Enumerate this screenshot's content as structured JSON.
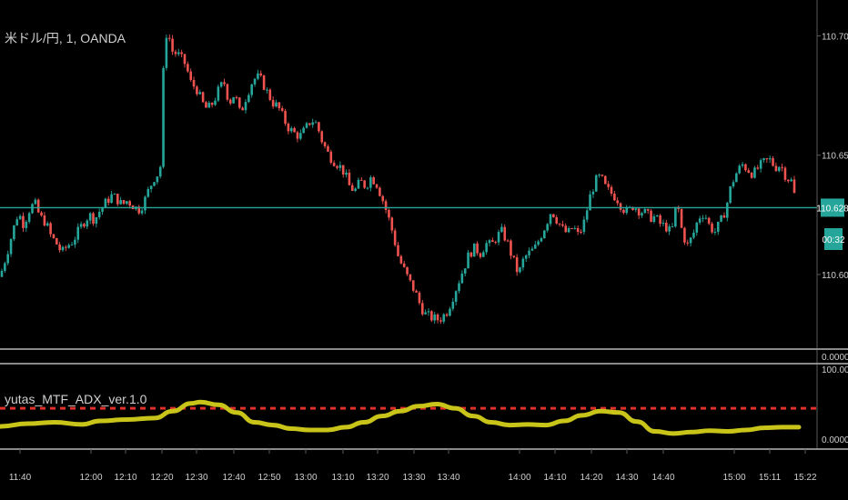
{
  "main_chart": {
    "title": "米ドル/円, 1, OANDA",
    "price_ticks": [
      "110.700",
      "110.650",
      "110.600"
    ],
    "current_price_badge": "110.628",
    "countdown_badge": "00:32",
    "colors": {
      "up": "#26a69a",
      "down": "#ef5350",
      "price_line": "#26a69a",
      "badge_bg": "#26a69a"
    }
  },
  "empty_pane": {
    "tick": "0.0000"
  },
  "indicator": {
    "title": "yutas_MTF_ADX_ver.1.0",
    "ticks": [
      "100.0000",
      "0.0000"
    ],
    "colors": {
      "adx": "#c8c41a",
      "threshold": "#e0302a"
    }
  },
  "time_axis": {
    "labels": [
      "11:40",
      "12:00",
      "12:10",
      "12:20",
      "12:30",
      "12:40",
      "12:50",
      "13:00",
      "13:10",
      "13:20",
      "13:30",
      "13:40",
      "14:00",
      "14:10",
      "14:20",
      "14:30",
      "14:40",
      "15:00",
      "15:11",
      "15:22"
    ]
  },
  "chart_data": [
    {
      "type": "candlestick",
      "title": "米ドル/円, 1, OANDA",
      "y_ticks": [
        110.7,
        110.65,
        110.6
      ],
      "ylim": [
        110.571,
        110.712
      ],
      "x_tick_labels": [
        "11:40",
        "12:00",
        "12:10",
        "12:20",
        "12:30",
        "12:40",
        "12:50",
        "13:00",
        "13:10",
        "13:20",
        "13:30",
        "13:40",
        "14:00",
        "14:10",
        "14:20",
        "14:30",
        "14:40",
        "15:00",
        "15:11",
        "15:22"
      ],
      "close_path": [
        [
          0,
          110.599
        ],
        [
          7,
          110.608
        ],
        [
          14,
          110.618
        ],
        [
          20,
          110.626
        ],
        [
          26,
          110.621
        ],
        [
          32,
          110.627
        ],
        [
          38,
          110.63
        ],
        [
          44,
          110.624
        ],
        [
          50,
          110.622
        ],
        [
          56,
          110.616
        ],
        [
          62,
          110.613
        ],
        [
          68,
          110.609
        ],
        [
          74,
          110.612
        ],
        [
          80,
          110.614
        ],
        [
          86,
          110.618
        ],
        [
          92,
          110.622
        ],
        [
          98,
          110.625
        ],
        [
          104,
          110.623
        ],
        [
          110,
          110.627
        ],
        [
          116,
          110.63
        ],
        [
          122,
          110.633
        ],
        [
          128,
          110.632
        ],
        [
          134,
          110.629
        ],
        [
          140,
          110.631
        ],
        [
          146,
          110.629
        ],
        [
          152,
          110.627
        ],
        [
          158,
          110.63
        ],
        [
          164,
          110.636
        ],
        [
          170,
          110.641
        ],
        [
          176,
          110.643
        ],
        [
          180,
          110.69
        ],
        [
          184,
          110.705
        ],
        [
          188,
          110.694
        ],
        [
          196,
          110.692
        ],
        [
          204,
          110.688
        ],
        [
          210,
          110.68
        ],
        [
          216,
          110.678
        ],
        [
          222,
          110.672
        ],
        [
          228,
          110.669
        ],
        [
          234,
          110.672
        ],
        [
          240,
          110.677
        ],
        [
          246,
          110.681
        ],
        [
          252,
          110.672
        ],
        [
          258,
          110.676
        ],
        [
          264,
          110.667
        ],
        [
          270,
          110.674
        ],
        [
          276,
          110.68
        ],
        [
          282,
          110.683
        ],
        [
          288,
          110.681
        ],
        [
          294,
          110.676
        ],
        [
          300,
          110.672
        ],
        [
          306,
          110.67
        ],
        [
          312,
          110.665
        ],
        [
          318,
          110.661
        ],
        [
          324,
          110.659
        ],
        [
          330,
          110.658
        ],
        [
          336,
          110.661
        ],
        [
          342,
          110.665
        ],
        [
          348,
          110.663
        ],
        [
          354,
          110.656
        ],
        [
          360,
          110.651
        ],
        [
          366,
          110.648
        ],
        [
          372,
          110.646
        ],
        [
          378,
          110.643
        ],
        [
          384,
          110.637
        ],
        [
          390,
          110.635
        ],
        [
          396,
          110.639
        ],
        [
          402,
          110.637
        ],
        [
          408,
          110.641
        ],
        [
          414,
          110.638
        ],
        [
          420,
          110.632
        ],
        [
          426,
          110.625
        ],
        [
          432,
          110.617
        ],
        [
          438,
          110.607
        ],
        [
          444,
          110.602
        ],
        [
          450,
          110.597
        ],
        [
          456,
          110.593
        ],
        [
          462,
          110.587
        ],
        [
          468,
          110.583
        ],
        [
          474,
          110.582
        ],
        [
          480,
          110.581
        ],
        [
          486,
          110.582
        ],
        [
          492,
          110.585
        ],
        [
          498,
          110.591
        ],
        [
          504,
          110.597
        ],
        [
          510,
          110.603
        ],
        [
          516,
          110.609
        ],
        [
          522,
          110.611
        ],
        [
          528,
          110.609
        ],
        [
          534,
          110.613
        ],
        [
          540,
          110.612
        ],
        [
          546,
          110.616
        ],
        [
          552,
          110.618
        ],
        [
          558,
          110.613
        ],
        [
          564,
          110.606
        ],
        [
          570,
          110.6
        ],
        [
          576,
          110.607
        ],
        [
          582,
          110.609
        ],
        [
          588,
          110.611
        ],
        [
          594,
          110.616
        ],
        [
          600,
          110.621
        ],
        [
          606,
          110.627
        ],
        [
          612,
          110.623
        ],
        [
          618,
          110.619
        ],
        [
          624,
          110.617
        ],
        [
          630,
          110.62
        ],
        [
          636,
          110.616
        ],
        [
          642,
          110.622
        ],
        [
          648,
          110.632
        ],
        [
          654,
          110.639
        ],
        [
          660,
          110.641
        ],
        [
          666,
          110.636
        ],
        [
          672,
          110.634
        ],
        [
          678,
          110.632
        ],
        [
          684,
          110.628
        ],
        [
          690,
          110.626
        ],
        [
          696,
          110.629
        ],
        [
          702,
          110.627
        ],
        [
          708,
          110.626
        ],
        [
          714,
          110.624
        ],
        [
          720,
          110.624
        ],
        [
          726,
          110.621
        ],
        [
          732,
          110.62
        ],
        [
          738,
          110.617
        ],
        [
          744,
          110.631
        ],
        [
          750,
          110.617
        ],
        [
          756,
          110.612
        ],
        [
          762,
          110.617
        ],
        [
          768,
          110.624
        ],
        [
          774,
          110.626
        ],
        [
          780,
          110.62
        ],
        [
          786,
          110.618
        ],
        [
          792,
          110.622
        ],
        [
          798,
          110.628
        ],
        [
          804,
          110.638
        ],
        [
          810,
          110.643
        ],
        [
          816,
          110.646
        ],
        [
          822,
          110.644
        ],
        [
          828,
          110.642
        ],
        [
          834,
          110.645
        ],
        [
          840,
          110.647
        ],
        [
          846,
          110.648
        ],
        [
          852,
          110.645
        ],
        [
          858,
          110.646
        ],
        [
          864,
          110.641
        ],
        [
          870,
          110.639
        ],
        [
          876,
          110.628
        ]
      ],
      "current_price": 110.628
    },
    {
      "type": "line",
      "title": "yutas_MTF_ADX_ver.1.0",
      "y_ticks": [
        100,
        0
      ],
      "ylim": [
        0,
        100
      ],
      "threshold": 44,
      "series": [
        {
          "values": [
            [
              0,
              18
            ],
            [
              30,
              22
            ],
            [
              60,
              24
            ],
            [
              90,
              21
            ],
            [
              110,
              26
            ],
            [
              140,
              28
            ],
            [
              170,
              30
            ],
            [
              190,
              40
            ],
            [
              210,
              51
            ],
            [
              220,
              53
            ],
            [
              240,
              49
            ],
            [
              260,
              38
            ],
            [
              280,
              24
            ],
            [
              300,
              20
            ],
            [
              320,
              15
            ],
            [
              340,
              13
            ],
            [
              360,
              13
            ],
            [
              380,
              17
            ],
            [
              400,
              24
            ],
            [
              420,
              33
            ],
            [
              440,
              40
            ],
            [
              460,
              47
            ],
            [
              480,
              50
            ],
            [
              500,
              44
            ],
            [
              520,
              33
            ],
            [
              540,
              24
            ],
            [
              560,
              20
            ],
            [
              580,
              21
            ],
            [
              600,
              20
            ],
            [
              620,
              26
            ],
            [
              640,
              34
            ],
            [
              660,
              40
            ],
            [
              680,
              38
            ],
            [
              700,
              25
            ],
            [
              720,
              11
            ],
            [
              740,
              8
            ],
            [
              760,
              10
            ],
            [
              780,
              12
            ],
            [
              800,
              11
            ],
            [
              820,
              13
            ],
            [
              840,
              16
            ],
            [
              860,
              17
            ],
            [
              878,
              17
            ]
          ]
        }
      ]
    }
  ]
}
